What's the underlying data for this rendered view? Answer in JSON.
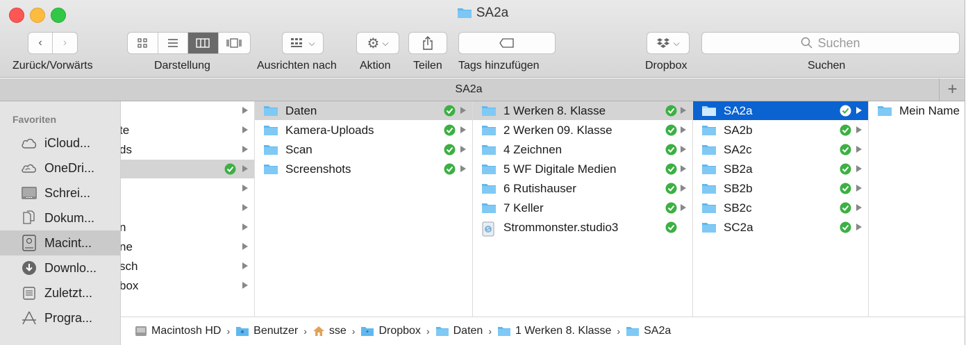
{
  "window": {
    "title": "SA2a"
  },
  "toolbar": {
    "nav_label": "Zurück/Vorwärts",
    "view_label": "Darstellung",
    "arrange_label": "Ausrichten nach",
    "action_label": "Aktion",
    "share_label": "Teilen",
    "tags_label": "Tags hinzufügen",
    "dropbox_label": "Dropbox",
    "search_label": "Suchen",
    "search_placeholder": "Suchen",
    "active_view": "columns"
  },
  "tabbar": {
    "title": "SA2a",
    "add": "+"
  },
  "sidebar": {
    "heading": "Favoriten",
    "items": [
      {
        "label": "iCloud...",
        "icon": "cloud-icon"
      },
      {
        "label": "OneDri...",
        "icon": "onedrive-icon"
      },
      {
        "label": "Schrei...",
        "icon": "desktop-icon"
      },
      {
        "label": "Dokum...",
        "icon": "documents-icon"
      },
      {
        "label": "Macint...",
        "icon": "harddisk-icon",
        "selected": true
      },
      {
        "label": "Downlo...",
        "icon": "downloads-icon"
      },
      {
        "label": "Zuletzt...",
        "icon": "recents-icon"
      },
      {
        "label": "Progra...",
        "icon": "applications-icon"
      }
    ]
  },
  "columns": {
    "col1": [
      {
        "name": ""
      },
      {
        "name": "te"
      },
      {
        "name": "ds"
      },
      {
        "name": "",
        "synced": true,
        "selected": true
      },
      {
        "name": ""
      },
      {
        "name": ""
      },
      {
        "name": "n"
      },
      {
        "name": "ne"
      },
      {
        "name": "sch"
      },
      {
        "name": "box"
      }
    ],
    "col2": [
      {
        "name": "Daten",
        "selected": true
      },
      {
        "name": "Kamera-Uploads"
      },
      {
        "name": "Scan"
      },
      {
        "name": "Screenshots"
      }
    ],
    "col3": [
      {
        "name": "1 Werken 8. Klasse",
        "selected": true
      },
      {
        "name": "2 Werken 09. Klasse"
      },
      {
        "name": "4 Zeichnen"
      },
      {
        "name": "5 WF Digitale Medien"
      },
      {
        "name": "6 Rutishauser"
      },
      {
        "name": "7 Keller"
      },
      {
        "name": "Strommonster.studio3",
        "file": true
      }
    ],
    "col4": [
      {
        "name": "SA2a",
        "selected": true
      },
      {
        "name": "SA2b"
      },
      {
        "name": "SA2c"
      },
      {
        "name": "SB2a"
      },
      {
        "name": "SB2b"
      },
      {
        "name": "SB2c"
      },
      {
        "name": "SC2a"
      }
    ],
    "col5": [
      {
        "name": "Mein Name"
      }
    ]
  },
  "pathbar": [
    {
      "label": "Macintosh HD",
      "icon": "harddisk-icon"
    },
    {
      "label": "Benutzer",
      "icon": "users-folder-icon"
    },
    {
      "label": "sse",
      "icon": "home-icon"
    },
    {
      "label": "Dropbox",
      "icon": "dropbox-folder-icon"
    },
    {
      "label": "Daten",
      "icon": "folder-icon"
    },
    {
      "label": "1 Werken 8. Klasse",
      "icon": "folder-icon"
    },
    {
      "label": "SA2a",
      "icon": "folder-icon"
    }
  ],
  "colors": {
    "selection_blue": "#0b63d1",
    "folder_blue": "#5fb8ef",
    "sync_green": "#3cb043"
  }
}
